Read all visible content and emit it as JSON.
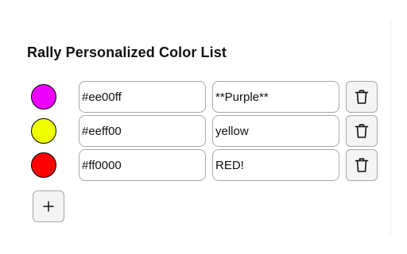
{
  "title": "Rally Personalized Color List",
  "colors": [
    {
      "hex": "#ee00ff",
      "name": "**Purple**",
      "swatch": "#ee00ff"
    },
    {
      "hex": "#eeff00",
      "name": "yellow",
      "swatch": "#eeff00"
    },
    {
      "hex": "#ff0000",
      "name": "RED!",
      "swatch": "#ff0000"
    }
  ],
  "icons": {
    "delete": "trash-icon",
    "add": "plus-icon"
  }
}
